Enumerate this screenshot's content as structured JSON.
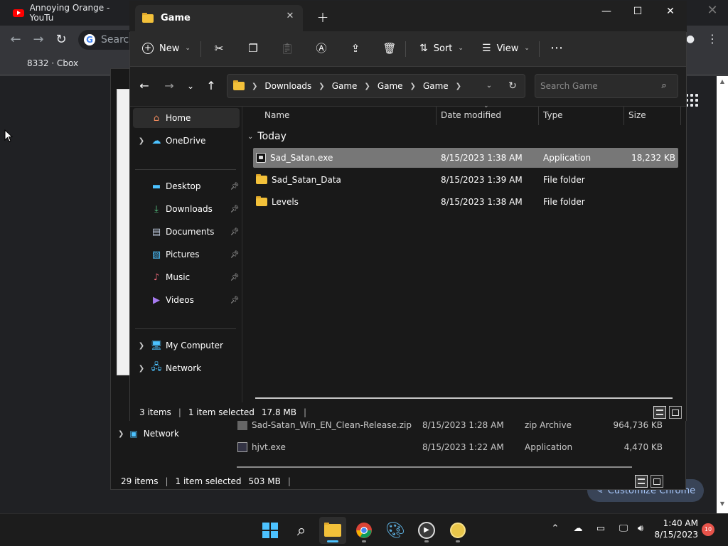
{
  "chrome": {
    "tab_title": "Annoying Orange - YouTu",
    "omnibox_text": "Search",
    "bookmark": "8332 · Cbox",
    "customize_label": "Customize Chrome"
  },
  "bg_explorer": {
    "nav_network": "Network",
    "rows": [
      {
        "name": "Sad-Satan_Win_EN_Clean-Release.zip",
        "date": "8/15/2023 1:28 AM",
        "type": "zip Archive",
        "size": "964,736 KB"
      },
      {
        "name": "hjvt.exe",
        "date": "8/15/2023 1:22 AM",
        "type": "Application",
        "size": "4,470 KB"
      }
    ],
    "status_items": "29 items",
    "status_selected": "1 item selected",
    "status_size": "503 MB"
  },
  "fg_explorer": {
    "tab_title": "Game",
    "commands": {
      "new": "New",
      "sort": "Sort",
      "view": "View"
    },
    "breadcrumb": [
      "Downloads",
      "Game",
      "Game",
      "Game"
    ],
    "search_placeholder": "Search Game",
    "nav": {
      "home": "Home",
      "onedrive": "OneDrive",
      "desktop": "Desktop",
      "downloads": "Downloads",
      "documents": "Documents",
      "pictures": "Pictures",
      "music": "Music",
      "videos": "Videos",
      "my_computer": "My Computer",
      "network": "Network"
    },
    "columns": {
      "name": "Name",
      "date": "Date modified",
      "type": "Type",
      "size": "Size"
    },
    "group": "Today",
    "files": [
      {
        "name": "Sad_Satan.exe",
        "date": "8/15/2023 1:38 AM",
        "type": "Application",
        "size": "18,232 KB",
        "icon": "exe-icon"
      },
      {
        "name": "Sad_Satan_Data",
        "date": "8/15/2023 1:39 AM",
        "type": "File folder",
        "size": "",
        "icon": "folder-icon"
      },
      {
        "name": "Levels",
        "date": "8/15/2023 1:38 AM",
        "type": "File folder",
        "size": "",
        "icon": "folder-icon"
      }
    ],
    "status_items": "3 items",
    "status_selected": "1 item selected",
    "status_size": "17.8 MB"
  },
  "taskbar": {
    "time": "1:40 AM",
    "date": "8/15/2023",
    "notifications": "10"
  },
  "colors": {
    "accent": "#4cc2ff",
    "selection": "#777777",
    "folder": "#f3c13a"
  }
}
